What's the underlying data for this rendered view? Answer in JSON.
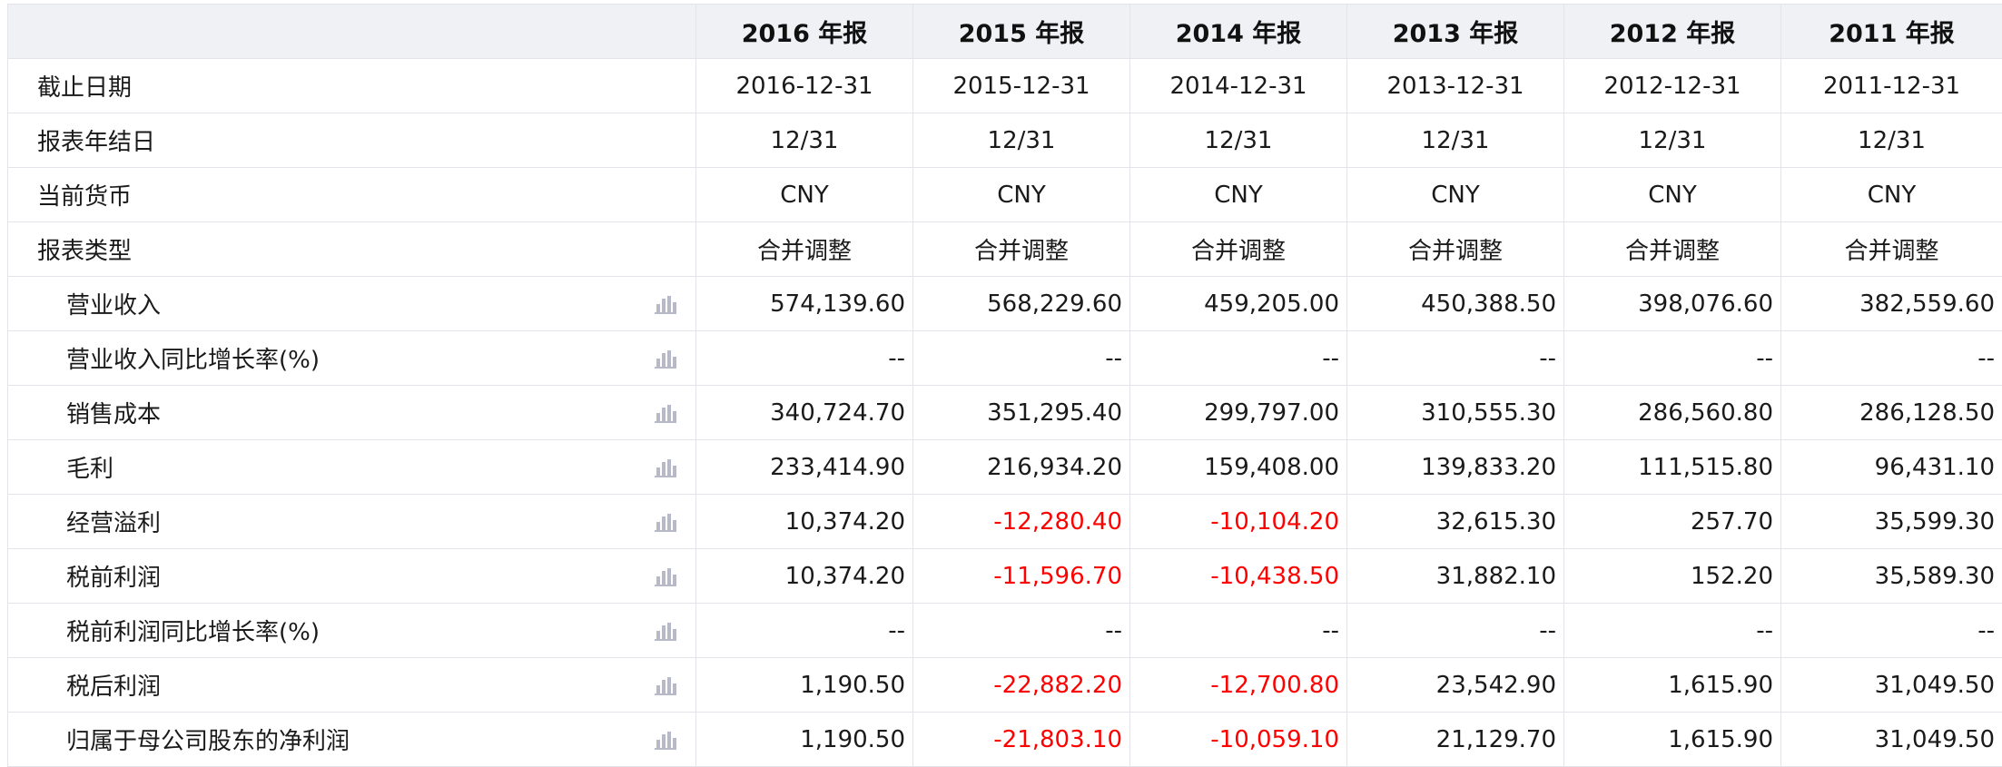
{
  "colors": {
    "header_bg": "#f0f1f5",
    "border": "#e3e4ea",
    "negative": "#ff0000",
    "chart_icon": "#b8b9c8"
  },
  "icons": {
    "row_chart": "bar-chart-icon"
  },
  "columns": [
    "2016 年报",
    "2015 年报",
    "2014 年报",
    "2013 年报",
    "2012 年报",
    "2011 年报"
  ],
  "meta_rows": [
    {
      "label": "截止日期",
      "values": [
        "2016-12-31",
        "2015-12-31",
        "2014-12-31",
        "2013-12-31",
        "2012-12-31",
        "2011-12-31"
      ]
    },
    {
      "label": "报表年结日",
      "values": [
        "12/31",
        "12/31",
        "12/31",
        "12/31",
        "12/31",
        "12/31"
      ]
    },
    {
      "label": "当前货币",
      "values": [
        "CNY",
        "CNY",
        "CNY",
        "CNY",
        "CNY",
        "CNY"
      ]
    },
    {
      "label": "报表类型",
      "values": [
        "合并调整",
        "合并调整",
        "合并调整",
        "合并调整",
        "合并调整",
        "合并调整"
      ]
    }
  ],
  "metric_rows": [
    {
      "label": "营业收入",
      "values": [
        "574,139.60",
        "568,229.60",
        "459,205.00",
        "450,388.50",
        "398,076.60",
        "382,559.60"
      ]
    },
    {
      "label": "营业收入同比增长率(%)",
      "values": [
        "--",
        "--",
        "--",
        "--",
        "--",
        "--"
      ]
    },
    {
      "label": "销售成本",
      "values": [
        "340,724.70",
        "351,295.40",
        "299,797.00",
        "310,555.30",
        "286,560.80",
        "286,128.50"
      ]
    },
    {
      "label": "毛利",
      "values": [
        "233,414.90",
        "216,934.20",
        "159,408.00",
        "139,833.20",
        "111,515.80",
        "96,431.10"
      ]
    },
    {
      "label": "经营溢利",
      "values": [
        "10,374.20",
        "-12,280.40",
        "-10,104.20",
        "32,615.30",
        "257.70",
        "35,599.30"
      ]
    },
    {
      "label": "税前利润",
      "values": [
        "10,374.20",
        "-11,596.70",
        "-10,438.50",
        "31,882.10",
        "152.20",
        "35,589.30"
      ]
    },
    {
      "label": "税前利润同比增长率(%)",
      "values": [
        "--",
        "--",
        "--",
        "--",
        "--",
        "--"
      ]
    },
    {
      "label": "税后利润",
      "values": [
        "1,190.50",
        "-22,882.20",
        "-12,700.80",
        "23,542.90",
        "1,615.90",
        "31,049.50"
      ]
    },
    {
      "label": "归属于母公司股东的净利润",
      "values": [
        "1,190.50",
        "-21,803.10",
        "-10,059.10",
        "21,129.70",
        "1,615.90",
        "31,049.50"
      ]
    }
  ]
}
